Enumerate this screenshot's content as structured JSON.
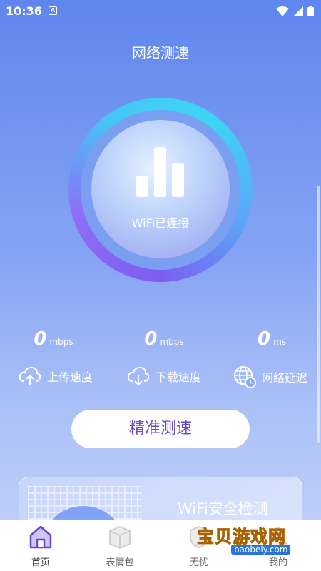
{
  "status_bar": {
    "time": "10:36",
    "notif_letter": "A"
  },
  "header": {
    "title": "网络测速"
  },
  "gauge": {
    "status": "WiFi已连接"
  },
  "stats": [
    {
      "value": "0",
      "unit": "mbps"
    },
    {
      "value": "0",
      "unit": "mbps"
    },
    {
      "value": "0",
      "unit": "ms"
    }
  ],
  "metrics": [
    {
      "label": "上传速度",
      "icon": "upload-cloud-icon"
    },
    {
      "label": "下载速度",
      "icon": "download-cloud-icon"
    },
    {
      "label": "网络延迟",
      "icon": "globe-clock-icon"
    }
  ],
  "primary_button": {
    "label": "精准测速"
  },
  "card": {
    "title": "WiFi安全检测"
  },
  "bottom_nav": [
    {
      "label": "首页",
      "icon": "home-icon",
      "active": true
    },
    {
      "label": "表情包",
      "icon": "box-icon",
      "active": false
    },
    {
      "label": "无忧",
      "icon": "shield-icon",
      "active": false
    },
    {
      "label": "我的",
      "icon": "user-icon",
      "active": false
    }
  ],
  "watermark": {
    "text": "宝贝游戏网",
    "url": "baobeiy.com"
  },
  "colors": {
    "accent": "#6a46c8",
    "background_top": "#5f86ee",
    "nav_active": "#6a46c8"
  }
}
